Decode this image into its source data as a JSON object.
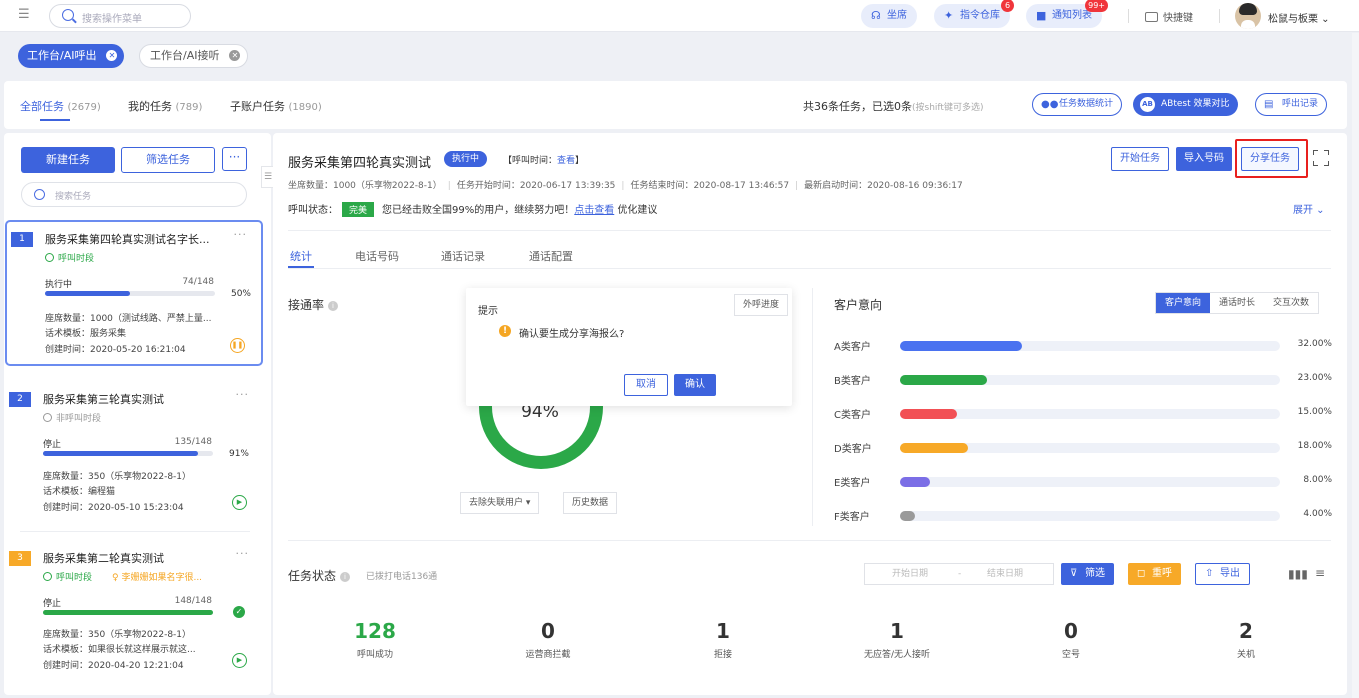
{
  "topbar": {
    "search_placeholder": "搜索操作菜单",
    "seat": "坐席",
    "repo": "指令仓库",
    "repo_badge": "6",
    "notify": "通知列表",
    "notify_badge": "99+",
    "shortcut": "快捷键",
    "user": "松鼠与板栗"
  },
  "tabs": {
    "t1": "工作台/AI呼出",
    "t2": "工作台/AI接听"
  },
  "header": {
    "all": "全部任务",
    "all_count": "(2679)",
    "mine": "我的任务",
    "mine_count": "(789)",
    "sub": "子账户任务",
    "sub_count": "(1890)",
    "total": "共36条任务，已选0条",
    "hint": "(按shift键可多选)",
    "stat_btn": "任务数据统计",
    "ab_btn": "ABtest 效果对比",
    "ab_icon": "AB",
    "record_btn": "呼出记录"
  },
  "left": {
    "new": "新建任务",
    "filter": "筛选任务",
    "more": "···",
    "search": "搜索任务",
    "tasks": [
      {
        "num": "1",
        "title": "服务采集第四轮真实测试名字长...",
        "time": "呼叫时段",
        "status": "执行中",
        "count": "74/148",
        "pct": "50%",
        "seats": "座席数量：1000（测试线路、严禁上量...",
        "tpl": "话术模板：服务采集",
        "created": "创建时间：2020-05-20 16:21:04",
        "fill": 0.5,
        "color": "#3d63dd"
      },
      {
        "num": "2",
        "title": "服务采集第三轮真实测试",
        "time": "非呼叫时段",
        "status": "停止",
        "count": "135/148",
        "pct": "91%",
        "seats": "座席数量：350（乐享物2022-8-1）",
        "tpl": "话术模板：编程猫",
        "created": "创建时间：2020-05-10 15:23:04",
        "fill": 0.91,
        "color": "#3d63dd"
      },
      {
        "num": "3",
        "title": "服务采集第二轮真实测试",
        "time": "呼叫时段",
        "agent": "李姗姗如果名字很...",
        "status": "停止",
        "count": "148/148",
        "pct": "",
        "seats": "座席数量：350（乐享物2022-8-1）",
        "tpl": "话术模板：如果很长就这样展示就这...",
        "created": "创建时间：2020-04-20 12:21:04",
        "fill": 1.0,
        "color": "#2ba848"
      }
    ]
  },
  "detail": {
    "title": "服务采集第四轮真实测试",
    "status": "执行中",
    "calltime_label": "【呼叫时间：",
    "calltime_link": "查看",
    "calltime_end": "】",
    "start": "开始任务",
    "import": "导入号码",
    "share": "分享任务",
    "seats": "坐席数量：1000（乐享物2022-8-1）",
    "task_start": "任务开始时间：2020-06-17  13:39:35",
    "task_end": "任务结束时间：2020-08-17  13:46:57",
    "latest": "最新启动时间：2020-08-16  09:36:17",
    "call_status": "呼叫状态：",
    "grade": "完美",
    "msg": "您已经击败全国99%的用户，继续努力吧！",
    "link": "点击查看",
    "suggest": "优化建议",
    "expand": "展开",
    "tabs": [
      "统计",
      "电话号码",
      "通话记录",
      "通话配置"
    ]
  },
  "rate": {
    "title": "接通率",
    "value": "94%",
    "value_num": 94,
    "remove": "去除失联用户",
    "history": "历史数据",
    "progress": "外呼进度"
  },
  "dialog": {
    "title": "提示",
    "msg": "确认要生成分享海报么?",
    "cancel": "取消",
    "ok": "确认"
  },
  "intent": {
    "title": "客户意向",
    "segs": [
      "客户意向",
      "通话时长",
      "交互次数"
    ],
    "rows": [
      {
        "label": "A类客户",
        "pct": "32.00%",
        "value": 32,
        "color": "#4a72f0"
      },
      {
        "label": "B类客户",
        "pct": "23.00%",
        "value": 23,
        "color": "#2ba848"
      },
      {
        "label": "C类客户",
        "pct": "15.00%",
        "value": 15,
        "color": "#f25055"
      },
      {
        "label": "D类客户",
        "pct": "18.00%",
        "value": 18,
        "color": "#f7a928"
      },
      {
        "label": "E类客户",
        "pct": "8.00%",
        "value": 8,
        "color": "#7b6ee6"
      },
      {
        "label": "F类客户",
        "pct": "4.00%",
        "value": 4,
        "color": "#9a9a9a"
      }
    ]
  },
  "taskstate": {
    "title": "任务状态",
    "dialed": "已拨打电话136通",
    "start_date": "开始日期",
    "dash": "-",
    "end_date": "结束日期",
    "filter": "筛选",
    "recall": "重呼",
    "export": "导出",
    "stats": [
      {
        "v": "128",
        "l": "呼叫成功"
      },
      {
        "v": "0",
        "l": "运营商拦截"
      },
      {
        "v": "1",
        "l": "拒接"
      },
      {
        "v": "1",
        "l": "无应答/无人接听"
      },
      {
        "v": "0",
        "l": "空号"
      },
      {
        "v": "2",
        "l": "关机"
      }
    ]
  }
}
